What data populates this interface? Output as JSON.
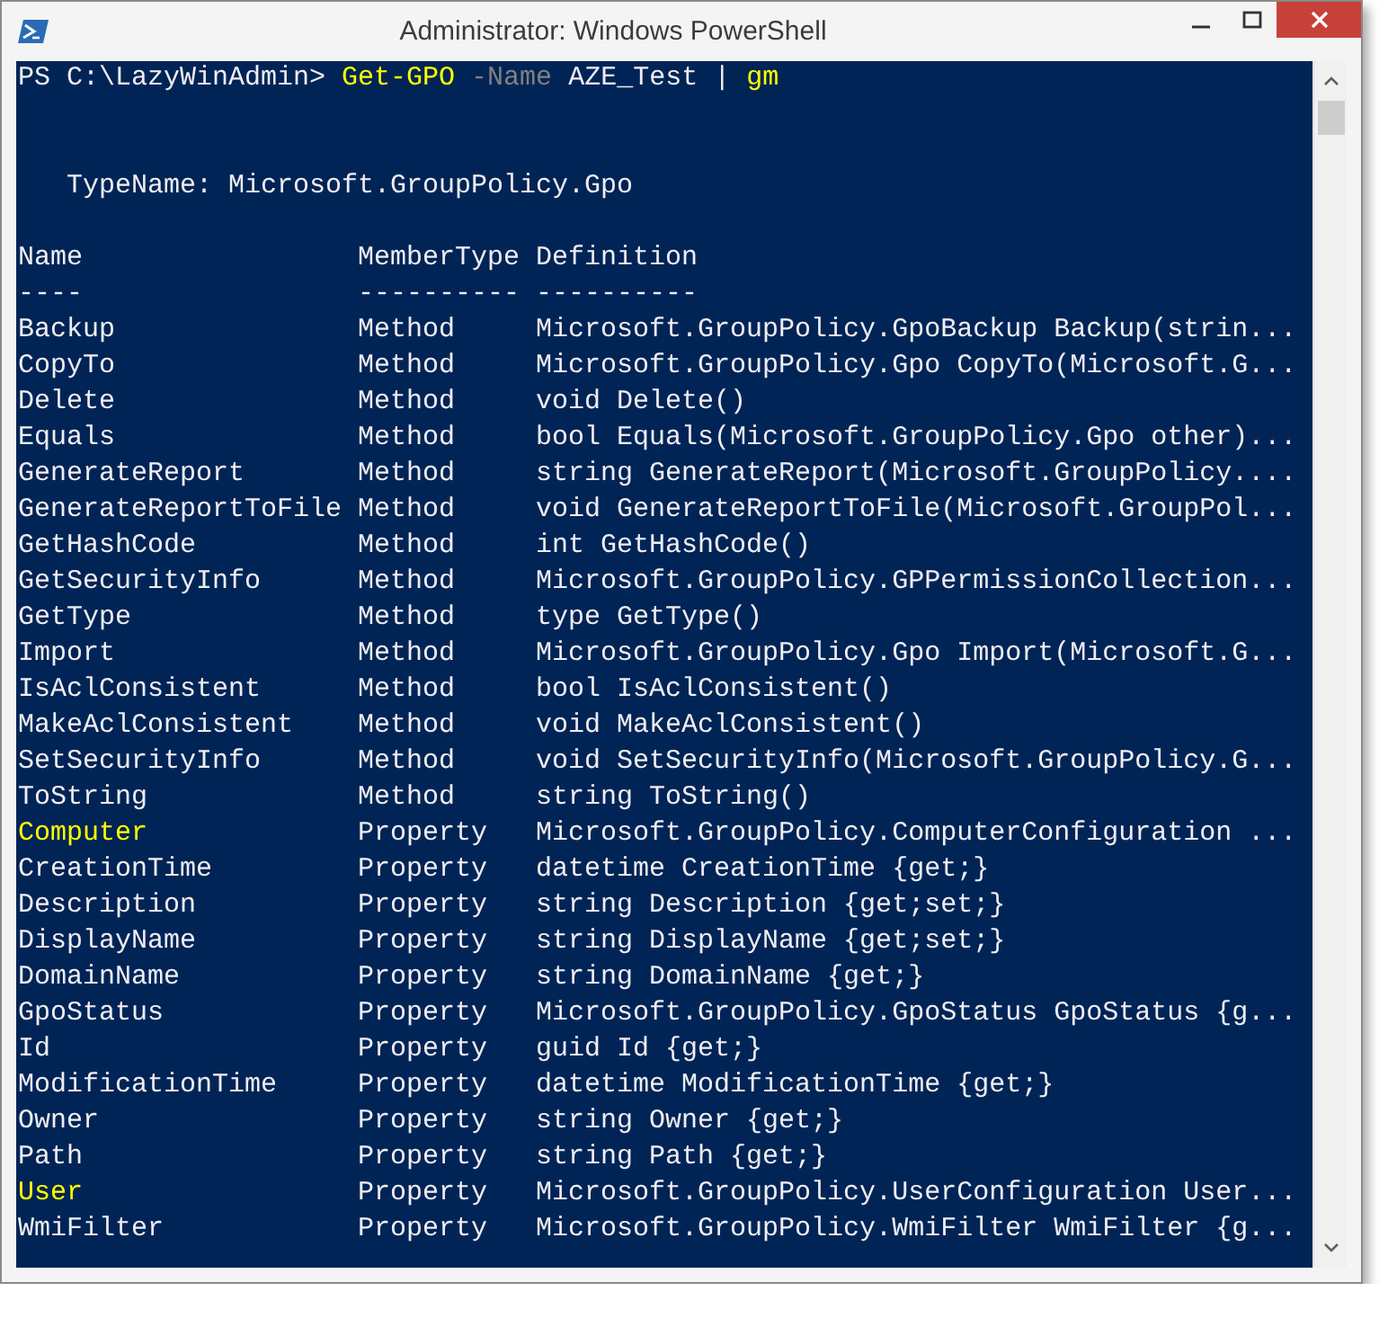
{
  "window": {
    "title": "Administrator: Windows PowerShell"
  },
  "console": {
    "command_line": [
      {
        "kind": "prompt",
        "text": "PS C:\\LazyWinAdmin> "
      },
      {
        "kind": "command",
        "text": "Get-GPO"
      },
      {
        "kind": "parameter",
        "text": " -Name"
      },
      {
        "kind": "argument",
        "text": " AZE_Test | "
      },
      {
        "kind": "command",
        "text": "gm"
      }
    ],
    "type_name": "TypeName: Microsoft.GroupPolicy.Gpo",
    "columns": [
      {
        "label": "Name",
        "underline": "----"
      },
      {
        "label": "MemberType",
        "underline": "----------"
      },
      {
        "label": "Definition",
        "underline": "----------"
      }
    ],
    "rows": [
      {
        "name": "Backup",
        "member_type": "Method",
        "definition": "Microsoft.GroupPolicy.GpoBackup Backup(strin...",
        "highlighted": false
      },
      {
        "name": "CopyTo",
        "member_type": "Method",
        "definition": "Microsoft.GroupPolicy.Gpo CopyTo(Microsoft.G...",
        "highlighted": false
      },
      {
        "name": "Delete",
        "member_type": "Method",
        "definition": "void Delete()",
        "highlighted": false
      },
      {
        "name": "Equals",
        "member_type": "Method",
        "definition": "bool Equals(Microsoft.GroupPolicy.Gpo other)...",
        "highlighted": false
      },
      {
        "name": "GenerateReport",
        "member_type": "Method",
        "definition": "string GenerateReport(Microsoft.GroupPolicy....",
        "highlighted": false
      },
      {
        "name": "GenerateReportToFile",
        "member_type": "Method",
        "definition": "void GenerateReportToFile(Microsoft.GroupPol...",
        "highlighted": false
      },
      {
        "name": "GetHashCode",
        "member_type": "Method",
        "definition": "int GetHashCode()",
        "highlighted": false
      },
      {
        "name": "GetSecurityInfo",
        "member_type": "Method",
        "definition": "Microsoft.GroupPolicy.GPPermissionCollection...",
        "highlighted": false
      },
      {
        "name": "GetType",
        "member_type": "Method",
        "definition": "type GetType()",
        "highlighted": false
      },
      {
        "name": "Import",
        "member_type": "Method",
        "definition": "Microsoft.GroupPolicy.Gpo Import(Microsoft.G...",
        "highlighted": false
      },
      {
        "name": "IsAclConsistent",
        "member_type": "Method",
        "definition": "bool IsAclConsistent()",
        "highlighted": false
      },
      {
        "name": "MakeAclConsistent",
        "member_type": "Method",
        "definition": "void MakeAclConsistent()",
        "highlighted": false
      },
      {
        "name": "SetSecurityInfo",
        "member_type": "Method",
        "definition": "void SetSecurityInfo(Microsoft.GroupPolicy.G...",
        "highlighted": false
      },
      {
        "name": "ToString",
        "member_type": "Method",
        "definition": "string ToString()",
        "highlighted": false
      },
      {
        "name": "Computer",
        "member_type": "Property",
        "definition": "Microsoft.GroupPolicy.ComputerConfiguration ...",
        "highlighted": true
      },
      {
        "name": "CreationTime",
        "member_type": "Property",
        "definition": "datetime CreationTime {get;}",
        "highlighted": false
      },
      {
        "name": "Description",
        "member_type": "Property",
        "definition": "string Description {get;set;}",
        "highlighted": false
      },
      {
        "name": "DisplayName",
        "member_type": "Property",
        "definition": "string DisplayName {get;set;}",
        "highlighted": false
      },
      {
        "name": "DomainName",
        "member_type": "Property",
        "definition": "string DomainName {get;}",
        "highlighted": false
      },
      {
        "name": "GpoStatus",
        "member_type": "Property",
        "definition": "Microsoft.GroupPolicy.GpoStatus GpoStatus {g...",
        "highlighted": false
      },
      {
        "name": "Id",
        "member_type": "Property",
        "definition": "guid Id {get;}",
        "highlighted": false
      },
      {
        "name": "ModificationTime",
        "member_type": "Property",
        "definition": "datetime ModificationTime {get;}",
        "highlighted": false
      },
      {
        "name": "Owner",
        "member_type": "Property",
        "definition": "string Owner {get;}",
        "highlighted": false
      },
      {
        "name": "Path",
        "member_type": "Property",
        "definition": "string Path {get;}",
        "highlighted": false
      },
      {
        "name": "User",
        "member_type": "Property",
        "definition": "Microsoft.GroupPolicy.UserConfiguration User...",
        "highlighted": true
      },
      {
        "name": "WmiFilter",
        "member_type": "Property",
        "definition": "Microsoft.GroupPolicy.WmiFilter WmiFilter {g...",
        "highlighted": false
      }
    ]
  }
}
